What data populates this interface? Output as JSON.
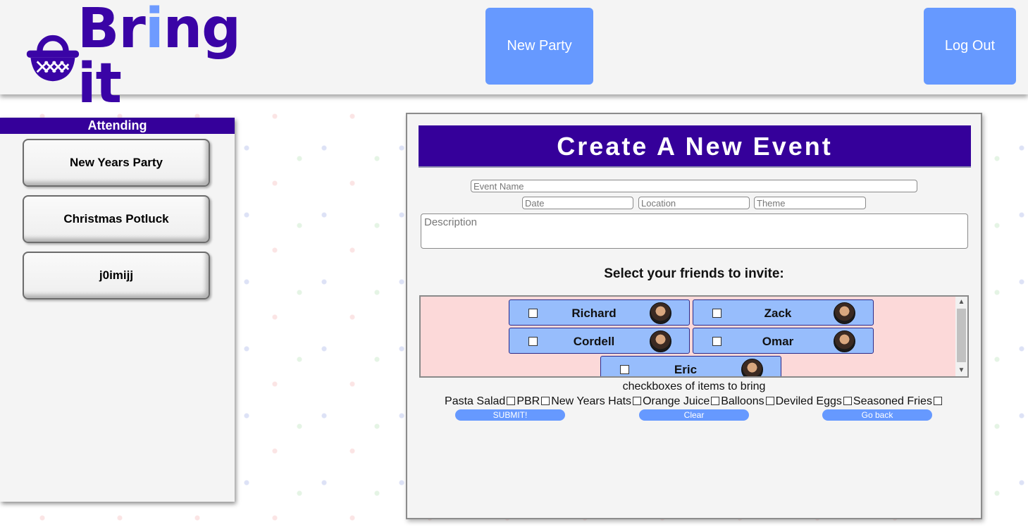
{
  "header": {
    "logo_text_pre": "Br",
    "logo_text_i": "i",
    "logo_text_post": "ng it",
    "logo_icon": "basket-icon",
    "new_party_label": "New Party",
    "logout_label": "Log Out"
  },
  "colors": {
    "brand": "#35009a",
    "accent": "#6699ff",
    "friend_card": "#97bdfc",
    "friends_bg": "#fcd9d9"
  },
  "sidebar": {
    "heading": "Attending",
    "events": [
      {
        "label": "New Years Party"
      },
      {
        "label": "Christmas Potluck"
      },
      {
        "label": "j0imijj"
      }
    ]
  },
  "form": {
    "title": "Create A New Event",
    "event_name_placeholder": "Event Name",
    "date_placeholder": "Date",
    "location_placeholder": "Location",
    "theme_placeholder": "Theme",
    "description_placeholder": "Description",
    "friends_label": "Select your friends to invite:",
    "friends": [
      {
        "name": "Richard"
      },
      {
        "name": "Zack"
      },
      {
        "name": "Cordell"
      },
      {
        "name": "Omar"
      },
      {
        "name": "Eric"
      }
    ],
    "items_caption": "checkboxes of items to bring",
    "items": [
      {
        "label": "Pasta Salad"
      },
      {
        "label": "PBR"
      },
      {
        "label": "New Years Hats"
      },
      {
        "label": "Orange Juice"
      },
      {
        "label": "Balloons"
      },
      {
        "label": "Deviled Eggs"
      },
      {
        "label": "Seasoned Fries"
      }
    ],
    "submit_label": "SUBMIT!",
    "clear_label": "Clear",
    "back_label": "Go back"
  }
}
